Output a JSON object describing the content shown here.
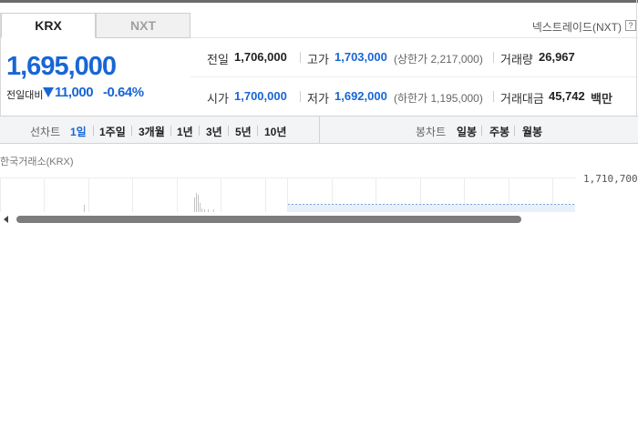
{
  "tabs": {
    "krx": "KRX",
    "nxt": "NXT"
  },
  "nxt_link": "넥스트레이드(NXT)",
  "help": "?",
  "price": {
    "current": "1,695,000",
    "change_label": "전일대비",
    "change_abs": "11,000",
    "change_pct": "-0.64%",
    "change_color": "#1866d6"
  },
  "stats": {
    "prev_close": {
      "label": "전일",
      "value": "1,706,000"
    },
    "high": {
      "label": "고가",
      "value": "1,703,000",
      "limit": "(상한가 2,217,000)"
    },
    "volume": {
      "label": "거래량",
      "value": "26,967"
    },
    "open": {
      "label": "시가",
      "value": "1,700,000"
    },
    "low": {
      "label": "저가",
      "value": "1,692,000",
      "limit": "(하한가 1,195,000)"
    },
    "amount": {
      "label": "거래대금",
      "value": "45,742",
      "unit": "백만"
    }
  },
  "line_chart": {
    "label": "선차트",
    "periods": [
      "1일",
      "1주일",
      "3개월",
      "1년",
      "3년",
      "5년",
      "10년"
    ],
    "selected": "1일"
  },
  "candle_chart": {
    "label": "봉차트",
    "periods": [
      "일봉",
      "주봉",
      "월봉"
    ]
  },
  "chart": {
    "source": "한국거래소(KRX)",
    "top_price": "1,710,700"
  }
}
